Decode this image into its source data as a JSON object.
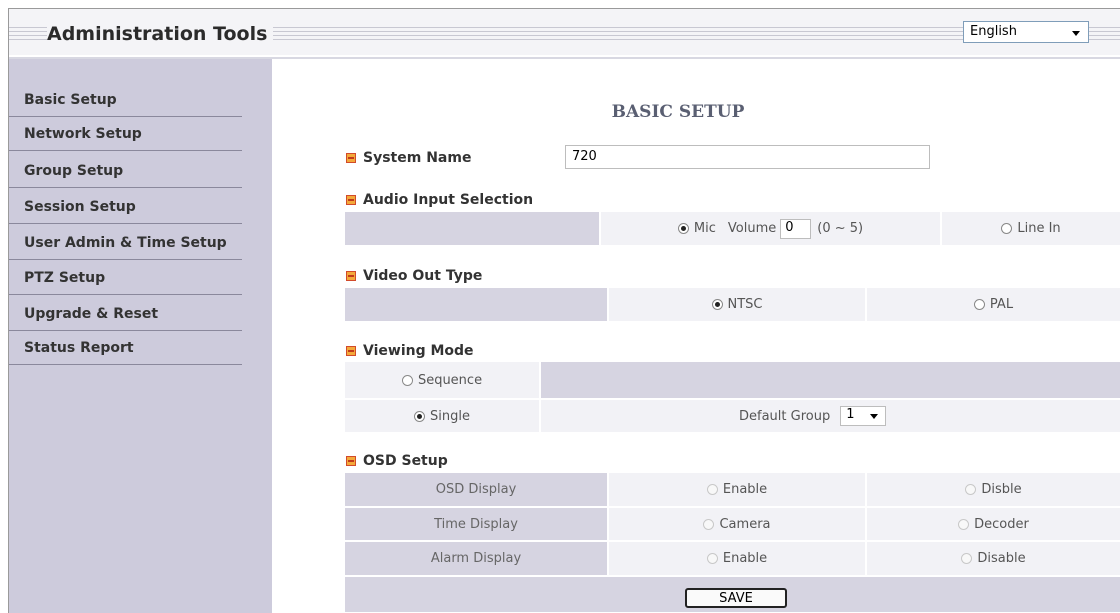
{
  "header": {
    "title": "Administration Tools",
    "language": "English"
  },
  "sidebar": {
    "items": [
      {
        "label": "Basic Setup"
      },
      {
        "label": "Network Setup"
      },
      {
        "label": "Group Setup"
      },
      {
        "label": "Session Setup"
      },
      {
        "label": "User Admin & Time Setup"
      },
      {
        "label": "PTZ Setup"
      },
      {
        "label": "Upgrade & Reset"
      },
      {
        "label": "Status Report"
      }
    ]
  },
  "main": {
    "title": "BASIC SETUP",
    "system_name": {
      "label": "System Name",
      "value": "720"
    },
    "audio": {
      "label": "Audio Input Selection",
      "mic_label": "Mic",
      "volume_label": "Volume",
      "volume_value": "0",
      "volume_range": "(0 ~ 5)",
      "line_in_label": "Line In",
      "selected": "Mic"
    },
    "video_out": {
      "label": "Video Out Type",
      "ntsc": "NTSC",
      "pal": "PAL",
      "selected": "NTSC"
    },
    "viewing_mode": {
      "label": "Viewing Mode",
      "sequence": "Sequence",
      "single": "Single",
      "default_group_label": "Default Group",
      "default_group_value": "1",
      "selected": "Single"
    },
    "osd": {
      "label": "OSD Setup",
      "rows": [
        {
          "name": "OSD Display",
          "opt1": "Enable",
          "opt2": "Disble"
        },
        {
          "name": "Time Display",
          "opt1": "Camera",
          "opt2": "Decoder"
        },
        {
          "name": "Alarm Display",
          "opt1": "Enable",
          "opt2": "Disable"
        }
      ]
    },
    "save_label": "SAVE"
  }
}
